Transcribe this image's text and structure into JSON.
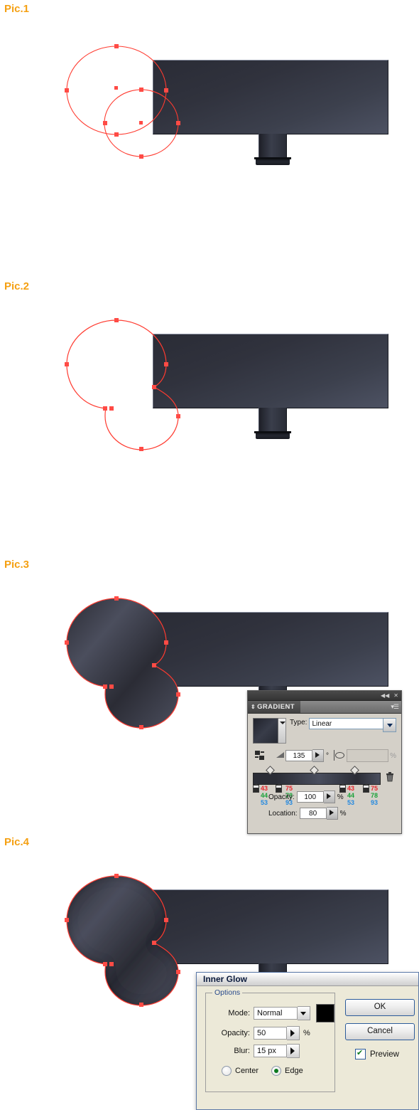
{
  "steps": [
    {
      "label": "Pic.1",
      "caption": "Two separate ellipse paths selected over a dark monitor shape"
    },
    {
      "label": "Pic.2",
      "caption": "Ellipses united into a single compound path"
    },
    {
      "label": "Pic.3",
      "caption": "United path filled with a linear gradient"
    },
    {
      "label": "Pic.4",
      "caption": "Inner Glow effect applied to the filled path"
    }
  ],
  "artwork": {
    "screen_fill_top": "#2a2c36",
    "screen_fill_bottom": "#4d5263",
    "path_stroke_color": "#ff3b30",
    "anchor_color": "#ff4b45"
  },
  "gradient_panel": {
    "title": "GRADIENT",
    "collapse_icon": "◀◀",
    "close_icon": "✕",
    "menu_icon": "panel-menu-icon",
    "type_label": "Type:",
    "type_value": "Linear",
    "angle_value": "135",
    "angle_unit": "°",
    "aspect_value": "",
    "aspect_unit": "%",
    "opacity_label": "Opacity:",
    "opacity_value": "100",
    "opacity_unit": "%",
    "location_label": "Location:",
    "location_value": "80",
    "location_unit": "%",
    "stops": [
      {
        "r": "43",
        "g": "44",
        "b": "53"
      },
      {
        "r": "75",
        "g": "78",
        "b": "93"
      },
      {
        "r": "43",
        "g": "44",
        "b": "53"
      },
      {
        "r": "75",
        "g": "78",
        "b": "93"
      }
    ]
  },
  "inner_glow_dialog": {
    "title": "Inner Glow",
    "group_legend": "Options",
    "mode_label": "Mode:",
    "mode_value": "Normal",
    "glow_color": "#000000",
    "opacity_label": "Opacity:",
    "opacity_value": "50",
    "opacity_unit": "%",
    "blur_label": "Blur:",
    "blur_value": "15 px",
    "center_label": "Center",
    "edge_label": "Edge",
    "selected_origin": "Edge",
    "ok_label": "OK",
    "cancel_label": "Cancel",
    "preview_label": "Preview",
    "preview_checked": true
  }
}
